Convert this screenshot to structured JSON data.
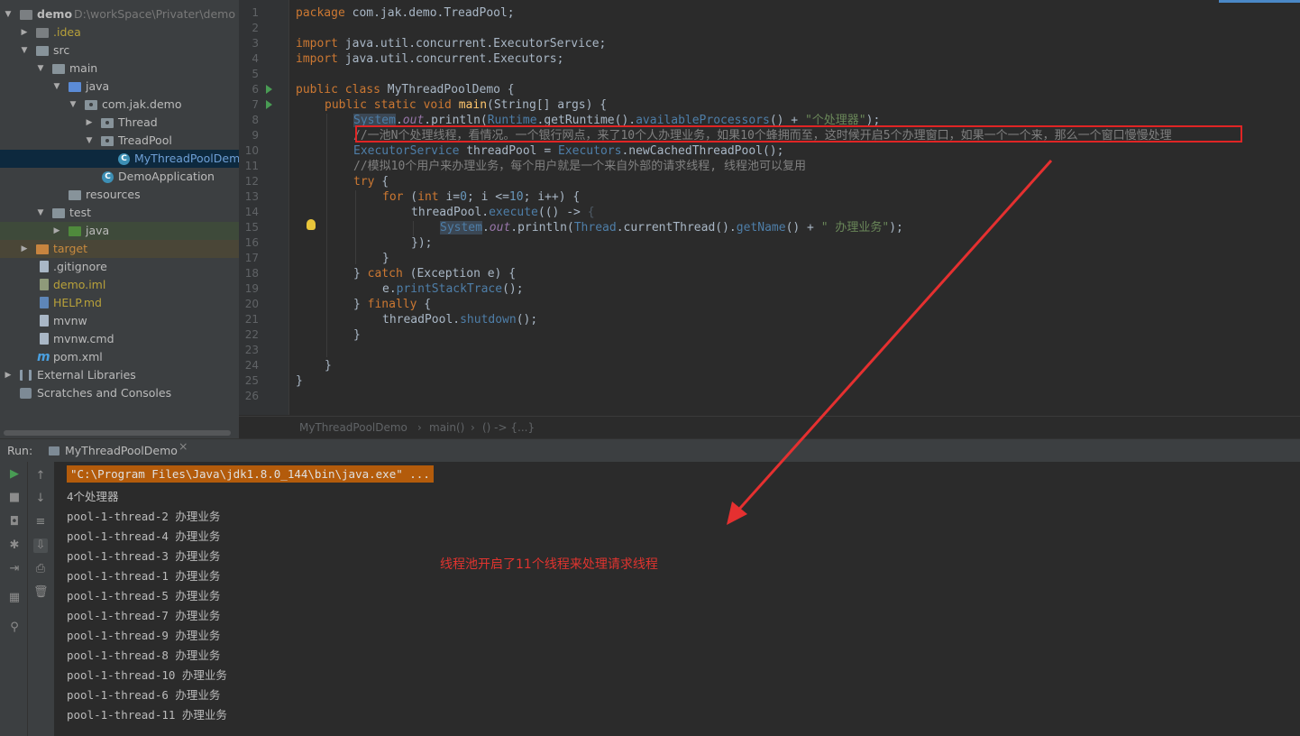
{
  "project_tree": {
    "root_name": "demo",
    "root_path": "D:\\workSpace\\Privater\\demo",
    "items": [
      {
        "label": ".idea"
      },
      {
        "label": "src"
      },
      {
        "label": "main"
      },
      {
        "label": "java"
      },
      {
        "label": "com.jak.demo"
      },
      {
        "label": "Thread"
      },
      {
        "label": "TreadPool"
      },
      {
        "label": "MyThreadPoolDemo"
      },
      {
        "label": "DemoApplication"
      },
      {
        "label": "resources"
      },
      {
        "label": "test"
      },
      {
        "label": "java"
      },
      {
        "label": "target"
      },
      {
        "label": ".gitignore"
      },
      {
        "label": "demo.iml"
      },
      {
        "label": "HELP.md"
      },
      {
        "label": "mvnw"
      },
      {
        "label": "mvnw.cmd"
      },
      {
        "label": "pom.xml"
      },
      {
        "label": "External Libraries"
      },
      {
        "label": "Scratches and Consoles"
      }
    ]
  },
  "editor": {
    "line_numbers": [
      "1",
      "2",
      "3",
      "4",
      "5",
      "6",
      "7",
      "8",
      "9",
      "10",
      "11",
      "12",
      "13",
      "14",
      "15",
      "16",
      "17",
      "18",
      "19",
      "20",
      "21",
      "22",
      "23",
      "24",
      "25",
      "26"
    ],
    "code": {
      "l1_kw": "package",
      "l1_rest": " com.jak.demo.TreadPool;",
      "l3_kw": "import",
      "l3_rest": " java.util.concurrent.ExecutorService;",
      "l4_kw": "import",
      "l4_rest": " java.util.concurrent.Executors;",
      "l6_kw": "public class ",
      "l6_cls": "MyThreadPoolDemo",
      "l6_rest": " {",
      "l7_kw": "public static void ",
      "l7_fn": "main",
      "l7_p1": "(",
      "l7_type": "String",
      "l7_rest": "[] args) {",
      "l8_sys": "System",
      "l8_dot": ".",
      "l8_out": "out",
      "l8_m1": ".println(",
      "l8_rt": "Runtime",
      "l8_m2": ".getRuntime().",
      "l8_ap": "availableProcessors",
      "l8_m3": "() + ",
      "l8_str": "\"个处理器\"",
      "l8_end": ");",
      "l9_comment": "//一池N个处理线程，看情况。一个银行网点，来了10个人办理业务，如果10个蜂拥而至，这时候开启5个办理窗口，如果一个一个来，那么一个窗口慢慢处理",
      "l10_type": "ExecutorService",
      "l10_mid": " threadPool = ",
      "l10_cls": "Executors",
      "l10_rest": ".newCachedThreadPool();",
      "l11_comment": "//模拟10个用户来办理业务，每个用户就是一个来自外部的请求线程, 线程池可以复用",
      "l12_kw": "try",
      "l12_rest": " {",
      "l13_kw": "for",
      "l13_a": " (",
      "l13_int": "int",
      "l13_b": " i=",
      "l13_n0": "0",
      "l13_c": "; i <=",
      "l13_n10": "10",
      "l13_d": "; i++) {",
      "l14_a": "threadPool.",
      "l14_ex": "execute",
      "l14_b": "(() -> ",
      "l14_c": "{",
      "l15_sys": "System",
      "l15_dot": ".",
      "l15_out": "out",
      "l15_m1": ".println(",
      "l15_th": "Thread",
      "l15_m2": ".currentThread().",
      "l15_gn": "getName",
      "l15_m3": "() + ",
      "l15_str": "\" 办理业务\"",
      "l15_end": ");",
      "l16": "});",
      "l17": "}",
      "l18_a": "} ",
      "l18_kw": "catch",
      "l18_b": " (",
      "l18_ex": "Exception",
      "l18_c": " e) {",
      "l19_a": "e.",
      "l19_m": "printStackTrace",
      "l19_b": "();",
      "l20_a": "} ",
      "l20_kw": "finally",
      "l20_b": " {",
      "l21_a": "threadPool.",
      "l21_m": "shutdown",
      "l21_b": "();",
      "l22": "}",
      "l24": "}",
      "l25": "}"
    },
    "breadcrumb": [
      "MyThreadPoolDemo",
      "main()",
      "() -> {...}"
    ],
    "breadcrumb_sep": "›"
  },
  "run_panel": {
    "label": "Run:",
    "tab_title": "MyThreadPoolDemo",
    "tab_close": "×",
    "command": "\"C:\\Program Files\\Java\\jdk1.8.0_144\\bin\\java.exe\" ...",
    "output_lines": [
      "4个处理器",
      "pool-1-thread-2 办理业务",
      "pool-1-thread-4 办理业务",
      "pool-1-thread-3 办理业务",
      "pool-1-thread-1 办理业务",
      "pool-1-thread-5 办理业务",
      "pool-1-thread-7 办理业务",
      "pool-1-thread-9 办理业务",
      "pool-1-thread-8 办理业务",
      "pool-1-thread-10 办理业务",
      "pool-1-thread-6 办理业务",
      "pool-1-thread-11 办理业务"
    ]
  },
  "annotation": {
    "note": "线程池开启了11个线程来处理请求线程",
    "color": "#e0342f"
  },
  "colors": {
    "keyword": "#cc7832",
    "string": "#6a8759",
    "comment": "#808080",
    "highlight_box": "#e02525",
    "command_bg": "#b35b0b"
  }
}
